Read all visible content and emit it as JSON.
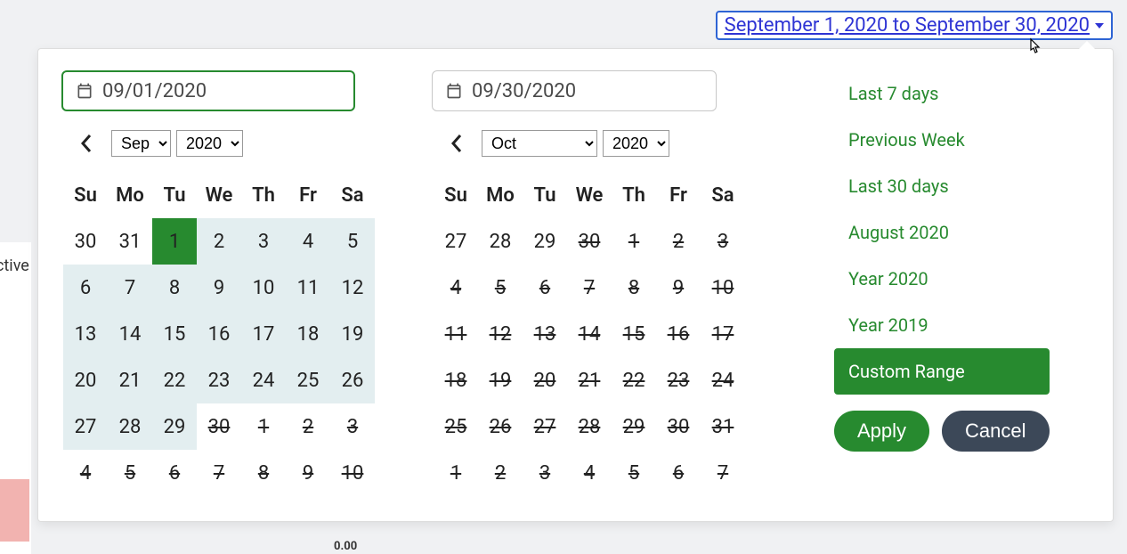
{
  "header": {
    "range_label": "September 1, 2020 to September 30, 2020"
  },
  "bg_fragment": "ctive",
  "below_number": "0.00",
  "inputs": {
    "start": "09/01/2020",
    "end": "09/30/2020"
  },
  "left_cal": {
    "month": "Sep",
    "year": "2020",
    "dow": [
      "Su",
      "Mo",
      "Tu",
      "We",
      "Th",
      "Fr",
      "Sa"
    ],
    "rows": [
      [
        {
          "n": "30",
          "t": "gray"
        },
        {
          "n": "31",
          "t": "gray"
        },
        {
          "n": "1",
          "t": "sel"
        },
        {
          "n": "2",
          "t": "inrange"
        },
        {
          "n": "3",
          "t": "inrange"
        },
        {
          "n": "4",
          "t": "inrange"
        },
        {
          "n": "5",
          "t": "inrange"
        }
      ],
      [
        {
          "n": "6",
          "t": "inrange"
        },
        {
          "n": "7",
          "t": "inrange"
        },
        {
          "n": "8",
          "t": "inrange"
        },
        {
          "n": "9",
          "t": "inrange"
        },
        {
          "n": "10",
          "t": "inrange"
        },
        {
          "n": "11",
          "t": "inrange"
        },
        {
          "n": "12",
          "t": "inrange"
        }
      ],
      [
        {
          "n": "13",
          "t": "inrange"
        },
        {
          "n": "14",
          "t": "inrange"
        },
        {
          "n": "15",
          "t": "inrange"
        },
        {
          "n": "16",
          "t": "inrange"
        },
        {
          "n": "17",
          "t": "inrange"
        },
        {
          "n": "18",
          "t": "inrange"
        },
        {
          "n": "19",
          "t": "inrange"
        }
      ],
      [
        {
          "n": "20",
          "t": "inrange"
        },
        {
          "n": "21",
          "t": "inrange"
        },
        {
          "n": "22",
          "t": "inrange"
        },
        {
          "n": "23",
          "t": "inrange"
        },
        {
          "n": "24",
          "t": "inrange"
        },
        {
          "n": "25",
          "t": "inrange"
        },
        {
          "n": "26",
          "t": "inrange"
        }
      ],
      [
        {
          "n": "27",
          "t": "inrange"
        },
        {
          "n": "28",
          "t": "inrange"
        },
        {
          "n": "29",
          "t": "inrange"
        },
        {
          "n": "30",
          "t": "strike"
        },
        {
          "n": "1",
          "t": "strike"
        },
        {
          "n": "2",
          "t": "strike"
        },
        {
          "n": "3",
          "t": "strike"
        }
      ],
      [
        {
          "n": "4",
          "t": "strike"
        },
        {
          "n": "5",
          "t": "strike"
        },
        {
          "n": "6",
          "t": "strike"
        },
        {
          "n": "7",
          "t": "strike"
        },
        {
          "n": "8",
          "t": "strike"
        },
        {
          "n": "9",
          "t": "strike"
        },
        {
          "n": "10",
          "t": "strike"
        }
      ]
    ]
  },
  "right_cal": {
    "month": "Oct",
    "year": "2020",
    "dow": [
      "Su",
      "Mo",
      "Tu",
      "We",
      "Th",
      "Fr",
      "Sa"
    ],
    "rows": [
      [
        {
          "n": "27",
          "t": "gray"
        },
        {
          "n": "28",
          "t": "gray"
        },
        {
          "n": "29",
          "t": "gray"
        },
        {
          "n": "30",
          "t": "strike"
        },
        {
          "n": "1",
          "t": "strike"
        },
        {
          "n": "2",
          "t": "strike"
        },
        {
          "n": "3",
          "t": "strike"
        }
      ],
      [
        {
          "n": "4",
          "t": "strike"
        },
        {
          "n": "5",
          "t": "strike"
        },
        {
          "n": "6",
          "t": "strike"
        },
        {
          "n": "7",
          "t": "strike"
        },
        {
          "n": "8",
          "t": "strike"
        },
        {
          "n": "9",
          "t": "strike"
        },
        {
          "n": "10",
          "t": "strike"
        }
      ],
      [
        {
          "n": "11",
          "t": "strike"
        },
        {
          "n": "12",
          "t": "strike"
        },
        {
          "n": "13",
          "t": "strike"
        },
        {
          "n": "14",
          "t": "strike"
        },
        {
          "n": "15",
          "t": "strike"
        },
        {
          "n": "16",
          "t": "strike"
        },
        {
          "n": "17",
          "t": "strike"
        }
      ],
      [
        {
          "n": "18",
          "t": "strike"
        },
        {
          "n": "19",
          "t": "strike"
        },
        {
          "n": "20",
          "t": "strike"
        },
        {
          "n": "21",
          "t": "strike"
        },
        {
          "n": "22",
          "t": "strike"
        },
        {
          "n": "23",
          "t": "strike"
        },
        {
          "n": "24",
          "t": "strike"
        }
      ],
      [
        {
          "n": "25",
          "t": "strike"
        },
        {
          "n": "26",
          "t": "strike"
        },
        {
          "n": "27",
          "t": "strike"
        },
        {
          "n": "28",
          "t": "strike"
        },
        {
          "n": "29",
          "t": "strike"
        },
        {
          "n": "30",
          "t": "strike"
        },
        {
          "n": "31",
          "t": "strike"
        }
      ],
      [
        {
          "n": "1",
          "t": "strike"
        },
        {
          "n": "2",
          "t": "strike"
        },
        {
          "n": "3",
          "t": "strike"
        },
        {
          "n": "4",
          "t": "strike"
        },
        {
          "n": "5",
          "t": "strike"
        },
        {
          "n": "6",
          "t": "strike"
        },
        {
          "n": "7",
          "t": "strike"
        }
      ]
    ]
  },
  "ranges": [
    "Last 7 days",
    "Previous Week",
    "Last 30 days",
    "August 2020",
    "Year 2020",
    "Year 2019",
    "Custom Range"
  ],
  "active_range": "Custom Range",
  "buttons": {
    "apply": "Apply",
    "cancel": "Cancel"
  }
}
